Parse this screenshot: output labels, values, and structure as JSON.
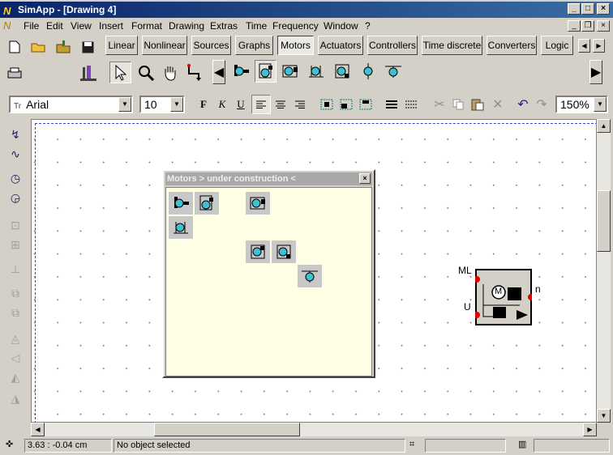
{
  "titlebar": {
    "title": "SimApp - [Drawing 4]",
    "logo": "N"
  },
  "menu": [
    "File",
    "Edit",
    "View",
    "Insert",
    "Format",
    "Drawing",
    "Extras",
    "Time",
    "Frequency",
    "Window",
    "?"
  ],
  "tabs": [
    "Linear",
    "Nonlinear",
    "Sources",
    "Graphs",
    "Motors",
    "Actuators",
    "Controllers",
    "Time discrete",
    "Converters",
    "Logic"
  ],
  "active_tab": "Motors",
  "format": {
    "font": "Arial",
    "size": "10",
    "zoom": "150%",
    "font_icon": "Tr"
  },
  "palette": {
    "title": "Motors > under construction <"
  },
  "block": {
    "label_ml": "ML",
    "label_u": "U",
    "label_n": "n",
    "symbol": "M"
  },
  "status": {
    "coords": "3.63 :  -0.04 cm",
    "selection": "No object selected"
  },
  "colors": {
    "accent": "#0a246a",
    "palette_bg": "#ffffe6",
    "icon": "#40c0d0",
    "port": "#e00000"
  }
}
